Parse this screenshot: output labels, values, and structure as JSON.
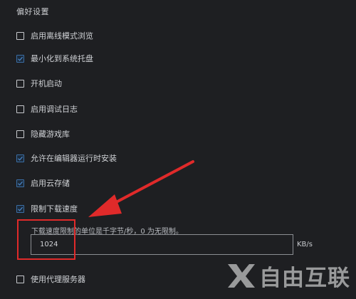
{
  "section": {
    "title": "偏好设置"
  },
  "options": [
    {
      "label": "启用离线模式浏览",
      "checked": false
    },
    {
      "label": "最小化到系统托盘",
      "checked": true
    },
    {
      "label": "开机启动",
      "checked": false
    },
    {
      "label": "启用调试日志",
      "checked": false
    },
    {
      "label": "隐藏游戏库",
      "checked": false
    },
    {
      "label": "允许在编辑器运行时安装",
      "checked": true
    },
    {
      "label": "启用云存储",
      "checked": true
    },
    {
      "label": "限制下载速度",
      "checked": true
    },
    {
      "label": "使用代理服务器",
      "checked": false
    }
  ],
  "download_limit": {
    "hint": "下载速度限制的单位是千字节/秒，0 为无限制。",
    "value": "1024",
    "unit": "KB/s"
  },
  "annotation": {
    "highlight_color": "#e02a2a",
    "arrow_color": "#e02a2a"
  },
  "watermark": {
    "text": "自由互联",
    "icon": "x-logo-icon"
  },
  "colors": {
    "background": "#1e1f22",
    "checkbox_checked": "#3b6ea5",
    "text": "#d0d2d6"
  }
}
